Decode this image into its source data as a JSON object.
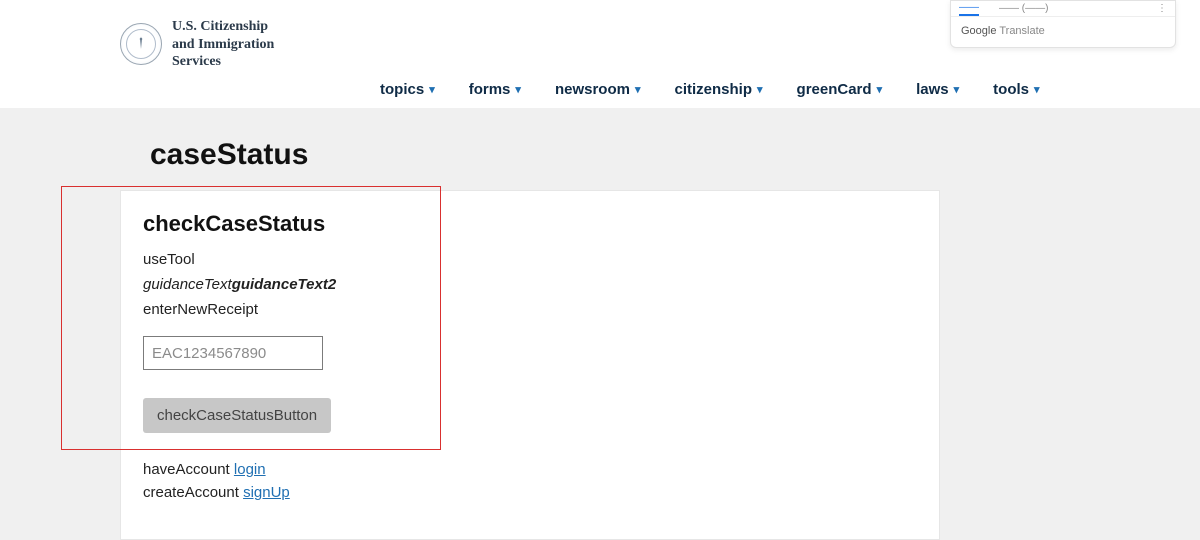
{
  "header": {
    "agency_line1": "U.S. Citizenship",
    "agency_line2": "and Immigration",
    "agency_line3": "Services",
    "nav": {
      "topics": "topics",
      "forms": "forms",
      "newsroom": "newsroom",
      "citizenship": "citizenship",
      "greenCard": "greenCard",
      "laws": "laws",
      "tools": "tools"
    }
  },
  "translate_widget": {
    "active_tab": "——",
    "other_tab": "—— (——)",
    "attribution_prefix": "Google",
    "attribution_rest": " Translate"
  },
  "main": {
    "page_title": "caseStatus",
    "section_title": "checkCaseStatus",
    "useTool": "useTool",
    "guidance1": "guidanceText",
    "guidance2": "guidanceText2",
    "enterReceipt": "enterNewReceipt",
    "receipt_placeholder": "EAC1234567890",
    "button_label": "checkCaseStatusButton",
    "haveAccount_prefix": "haveAccount ",
    "login_link": "login",
    "createAccount_prefix": "createAccount ",
    "signUp_link": "signUp"
  }
}
